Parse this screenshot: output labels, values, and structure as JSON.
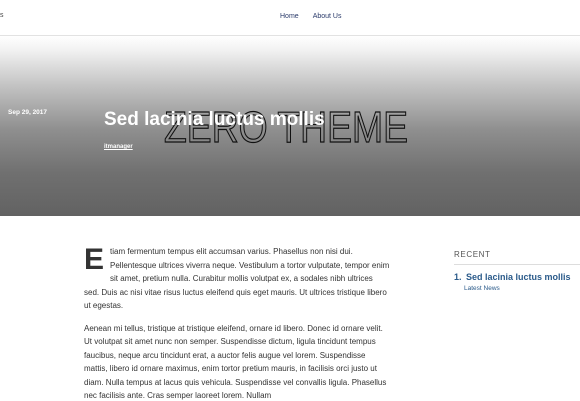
{
  "header": {
    "site_fragment": "s",
    "nav": [
      {
        "label": "Home"
      },
      {
        "label": "About Us"
      }
    ]
  },
  "hero": {
    "logo_text": "ZERO THEME",
    "date": "Sep 29, 2017",
    "title": "Sed lacinia luctus mollis",
    "author": "itmanager"
  },
  "article": {
    "dropcap": "E",
    "p1": "tiam fermentum tempus elit accumsan varius. Phasellus non nisi dui. Pellentesque ultrices viverra neque. Vestibulum a tortor vulputate, tempor enim sit amet, pretium nulla. Curabitur mollis volutpat ex, a sodales nibh ultrices sed. Duis ac nisi vitae risus luctus eleifend quis eget mauris. Ut ultrices tristique libero ut egestas.",
    "p2": "Aenean mi tellus, tristique at tristique eleifend, ornare id libero. Donec id ornare velit. Ut volutpat sit amet nunc non semper. Suspendisse dictum, ligula tincidunt tempus faucibus, neque arcu tincidunt erat, a auctor felis augue vel lorem. Suspendisse mattis, libero id ornare maximus, enim tortor pretium mauris, in facilisis orci justo ut diam. Nulla tempus at lacus quis vehicula. Suspendisse vel convallis ligula. Phasellus nec facilisis ante. Cras semper laoreet lorem. Nullam"
  },
  "sidebar": {
    "heading": "RECENT",
    "items": [
      {
        "num": "1.",
        "title": "Sed lacinia luctus mollis",
        "category": "Latest News"
      }
    ]
  }
}
